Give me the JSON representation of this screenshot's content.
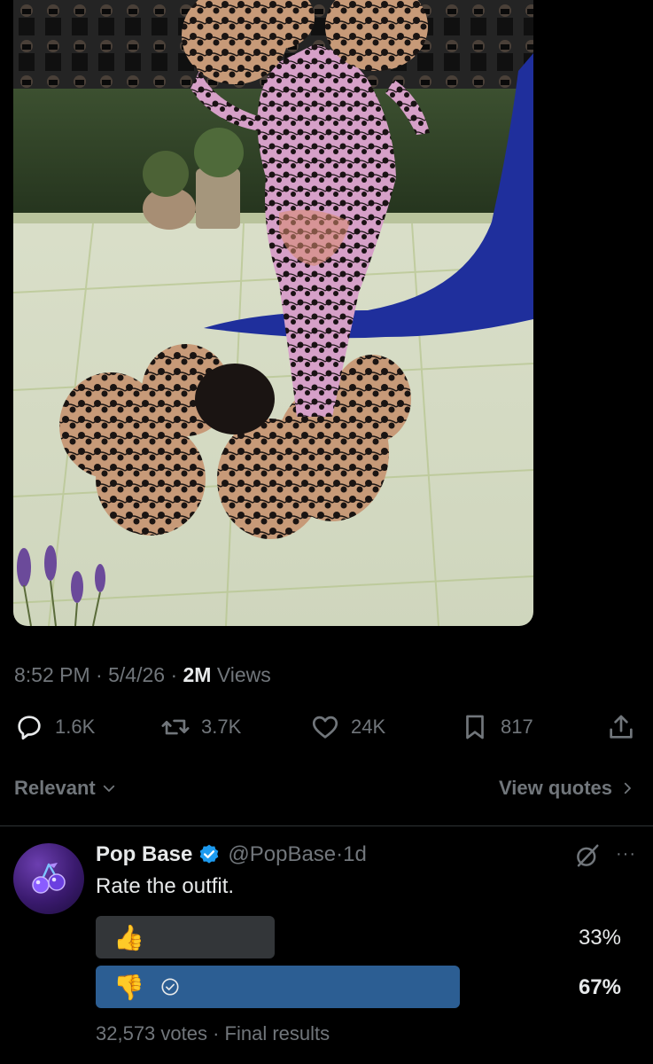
{
  "photo": {
    "alt_icon": "event-photo-lace-gown"
  },
  "tweet_meta": {
    "time": "8:52 PM",
    "sep1": " · ",
    "date": "5/4/26",
    "sep2": " · ",
    "views_count": "2M",
    "views_label": " Views"
  },
  "actions": {
    "replies": "1.6K",
    "reposts": "3.7K",
    "likes": "24K",
    "bookmarks": "817"
  },
  "replies_header": {
    "sort_label": "Relevant",
    "view_quotes_label": "View quotes"
  },
  "reply": {
    "name": "Pop Base",
    "handle": "@PopBase",
    "sep": " · ",
    "age": "1d",
    "text": "Rate the outfit.",
    "avatar_icon": "cherry-icon",
    "poll": {
      "options": [
        {
          "emoji": "👍",
          "percent": "33%",
          "selected": false,
          "value": 0.33
        },
        {
          "emoji": "👎",
          "percent": "67%",
          "selected": true,
          "value": 0.67
        }
      ],
      "votes": "32,573 votes",
      "sep": " · ",
      "status": "Final results"
    }
  },
  "colors": {
    "background": "#000000",
    "text": "#e7e9ea",
    "muted": "#71767b",
    "poll_winner": "#2c5e93",
    "poll_other": "#333639",
    "verified": "#1d9bf0"
  }
}
